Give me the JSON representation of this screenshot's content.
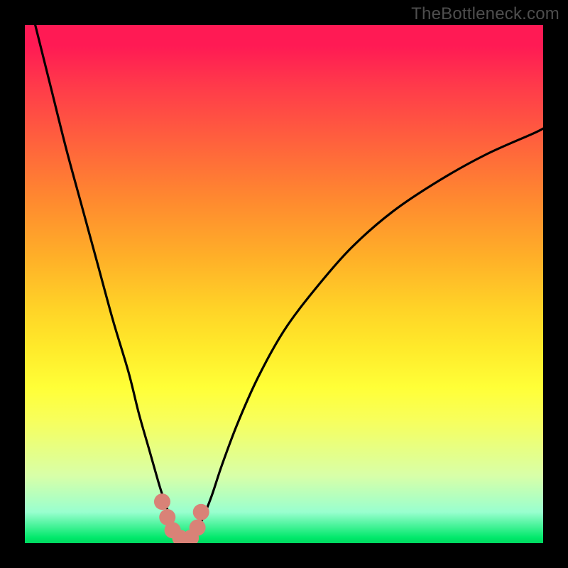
{
  "watermark": "TheBottleneck.com",
  "colors": {
    "background": "#000000",
    "curve": "#000000",
    "marker": "#d98277",
    "gradient_top": "#ff1a54",
    "gradient_bottom": "#00d760"
  },
  "chart_data": {
    "type": "line",
    "title": "",
    "xlabel": "",
    "ylabel": "",
    "xlim": [
      0,
      100
    ],
    "ylim": [
      0,
      100
    ],
    "grid": false,
    "series": [
      {
        "name": "left-curve",
        "x": [
          2,
          5,
          8,
          11,
          14,
          17,
          20,
          22,
          24,
          26,
          27,
          28,
          29,
          30,
          31
        ],
        "y": [
          100,
          88,
          76,
          65,
          54,
          43,
          33,
          25,
          18,
          11,
          8,
          5,
          3,
          1.5,
          0.5
        ]
      },
      {
        "name": "right-curve",
        "x": [
          32,
          33,
          34,
          36,
          38,
          41,
          45,
          50,
          56,
          63,
          71,
          80,
          89,
          98,
          100
        ],
        "y": [
          0.5,
          2,
          4,
          9,
          15,
          23,
          32,
          41,
          49,
          57,
          64,
          70,
          75,
          79,
          80
        ]
      }
    ],
    "markers": [
      {
        "name": "left-arm-top",
        "x": 26.5,
        "y": 8
      },
      {
        "name": "left-arm-mid",
        "x": 27.5,
        "y": 5
      },
      {
        "name": "left-arm-low",
        "x": 28.5,
        "y": 2.5
      },
      {
        "name": "valley-left",
        "x": 30,
        "y": 1
      },
      {
        "name": "valley-right",
        "x": 32,
        "y": 1
      },
      {
        "name": "right-arm-low",
        "x": 33.3,
        "y": 3
      },
      {
        "name": "right-arm-top",
        "x": 34,
        "y": 6
      }
    ],
    "annotations": []
  }
}
